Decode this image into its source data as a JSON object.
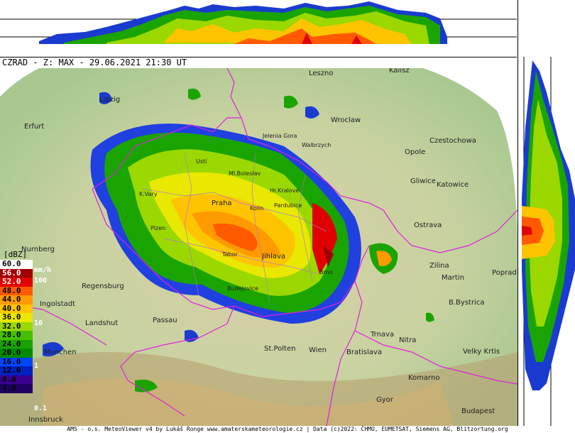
{
  "title": "CZRAD - Z: MAX - 29.06.2021 21:30 UT",
  "footer": "AMS - o.s. MeteoViewer v4 by Lukáš Ronge www.amaterskameteorologie.cz | Data (c)2022: ČHMÚ, EUMETSAT, Siemens AG, Blitzortung.org",
  "legend": {
    "unit_dbz": "[dBZ]",
    "unit_rate": "mm/h",
    "items": [
      {
        "label": "60.0",
        "color": "#ffffff",
        "text": "#000000"
      },
      {
        "label": "56.0",
        "color": "#a00000",
        "text": "#ffffff"
      },
      {
        "label": "52.0",
        "color": "#e00000",
        "text": "#ffffff"
      },
      {
        "label": "48.0",
        "color": "#ff5a00",
        "text": "#000000"
      },
      {
        "label": "44.0",
        "color": "#ff9a00",
        "text": "#000000"
      },
      {
        "label": "40.0",
        "color": "#ffc400",
        "text": "#000000"
      },
      {
        "label": "36.0",
        "color": "#e8e800",
        "text": "#000000"
      },
      {
        "label": "32.0",
        "color": "#9ad800",
        "text": "#000000"
      },
      {
        "label": "28.0",
        "color": "#46c000",
        "text": "#000000"
      },
      {
        "label": "24.0",
        "color": "#1aa400",
        "text": "#000000"
      },
      {
        "label": "20.0",
        "color": "#008c00",
        "text": "#000000"
      },
      {
        "label": "16.0",
        "color": "#0046ff",
        "text": "#000000"
      },
      {
        "label": "12.0",
        "color": "#0020c0",
        "text": "#000000"
      },
      {
        "label": "8.0",
        "color": "#380090",
        "text": "#000000"
      },
      {
        "label": "4.0",
        "color": "#200060",
        "text": "#000000"
      }
    ],
    "rate_labels": [
      "100",
      "10",
      "1",
      "0.1"
    ]
  },
  "cities": {
    "leszno": "Leszno",
    "kalisz": "Kalisz",
    "lipzig": "Lipzig",
    "wroclaw": "Wroclaw",
    "erfurt": "Erfurt",
    "jelenia": "Jelenia Gora",
    "walbrzych": "Walbrzych",
    "czestochowa": "Czestochowa",
    "opole": "Opole",
    "gliwice": "Gliwice",
    "katowice": "Katowice",
    "ostrava": "Ostrava",
    "zilina": "Zilina",
    "martin": "Martin",
    "poprad": "Poprad",
    "bbystrica": "B.Bystrica",
    "nitra": "Nitra",
    "trnava": "Trnava",
    "bratislava": "Bratislava",
    "vkrtis": "Velky Krtis",
    "komarno": "Komarno",
    "gyor": "Gyor",
    "budapest": "Budapest",
    "stpolten": "St.Polten",
    "wien": "Wien",
    "passau": "Passau",
    "landshut": "Landshut",
    "ingolstadt": "Ingolstadt",
    "regensburg": "Regensburg",
    "nurnberg": "Nurnberg",
    "munchen": "Munchen",
    "innsbruck": "Innsbruck",
    "praha": "Praha",
    "kolin": "Kolin",
    "pardubice": "Pardubice",
    "hkralove": "Hr.Kralove",
    "tabor": "Tabor",
    "jihlava": "Jihlava",
    "brno": "Brno",
    "kvary": "K.Vary",
    "plzen": "Plzen",
    "budejovice": "Budejovice",
    "usti": "Ustí",
    "mboleslav": "Ml.Boleslav"
  }
}
